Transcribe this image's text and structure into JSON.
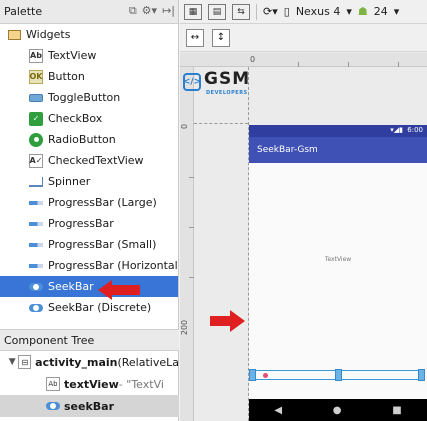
{
  "palette": {
    "title": "Palette",
    "header_icons": [
      "restore-icon",
      "gear-icon",
      "collapse-icon"
    ],
    "widgets_group": "Widgets",
    "items": [
      {
        "label": "TextView",
        "icon": "textview-icon"
      },
      {
        "label": "Button",
        "icon": "button-icon"
      },
      {
        "label": "ToggleButton",
        "icon": "togglebutton-icon"
      },
      {
        "label": "CheckBox",
        "icon": "checkbox-icon"
      },
      {
        "label": "RadioButton",
        "icon": "radiobutton-icon"
      },
      {
        "label": "CheckedTextView",
        "icon": "checkedtextview-icon"
      },
      {
        "label": "Spinner",
        "icon": "spinner-icon"
      },
      {
        "label": "ProgressBar (Large)",
        "icon": "progressbar-icon"
      },
      {
        "label": "ProgressBar",
        "icon": "progressbar-icon"
      },
      {
        "label": "ProgressBar (Small)",
        "icon": "progressbar-icon"
      },
      {
        "label": "ProgressBar (Horizontal)",
        "icon": "progressbar-icon"
      },
      {
        "label": "SeekBar",
        "icon": "seekbar-icon",
        "selected": true
      },
      {
        "label": "SeekBar (Discrete)",
        "icon": "seekbar-icon"
      }
    ]
  },
  "component_tree": {
    "title": "Component Tree",
    "root_label": "activity_main",
    "root_type": " (RelativeLa",
    "children": [
      {
        "name": "textView",
        "detail": " - \"TextVi"
      },
      {
        "name": "seekBar",
        "detail": ""
      }
    ]
  },
  "toolbar": {
    "device": "Nexus 4",
    "api": "24"
  },
  "ruler": {
    "top_label": "0",
    "left_label_0": "0",
    "left_label_200": "200"
  },
  "logo": {
    "main": "GSM",
    "sub": "DEVELOPERS"
  },
  "device_preview": {
    "status_time": "6:00",
    "app_title": "SeekBar-Gsm",
    "textview_text": "TextView",
    "seekbar_progress": 0.0
  },
  "colors": {
    "selection": "#3875d7",
    "primary": "#3f51b5",
    "primary_dark": "#303f9f",
    "arrow": "#e02020"
  }
}
